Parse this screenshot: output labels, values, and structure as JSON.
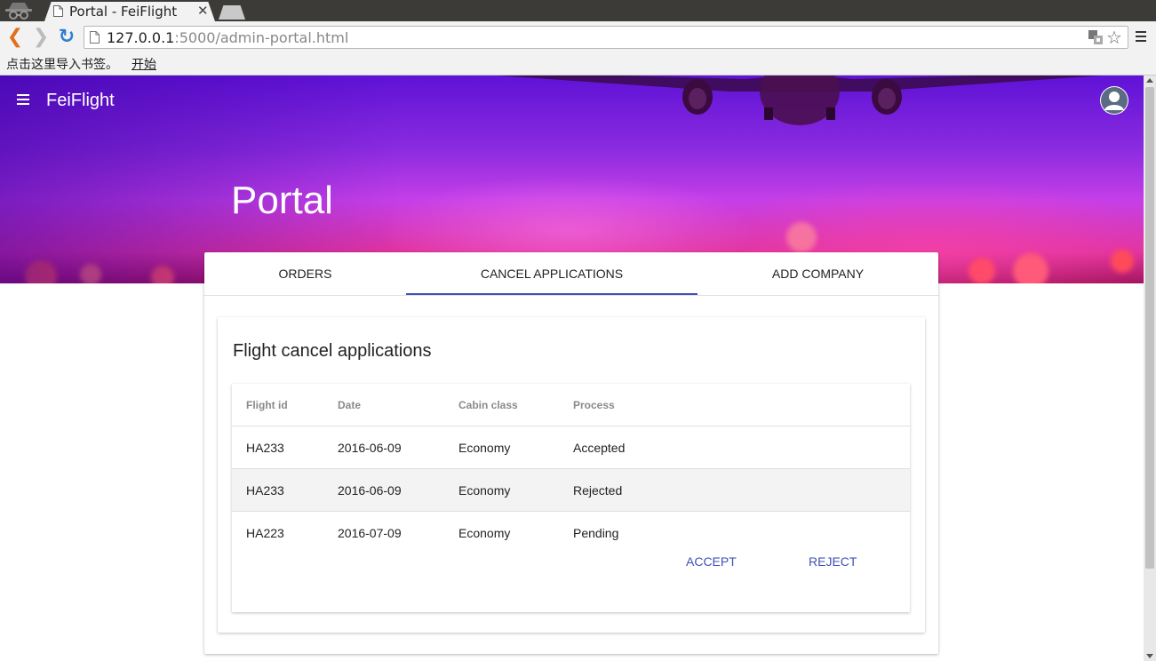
{
  "browser": {
    "tab_title": "Portal - FeiFlight",
    "tab_close": "✕",
    "url_host": "127.0.0.1",
    "url_rest": ":5000/admin-portal.html",
    "bookmarks_prompt": "点击这里导入书签。",
    "bookmarks_link": "开始",
    "back_glyph": "❮",
    "forward_glyph": "❯",
    "reload_glyph": "↻",
    "star_glyph": "☆"
  },
  "app": {
    "name": "FeiFlight",
    "page_title": "Portal",
    "accent_color": "#3f51b5"
  },
  "tabs": [
    {
      "label": "ORDERS"
    },
    {
      "label": "CANCEL APPLICATIONS"
    },
    {
      "label": "ADD COMPANY"
    }
  ],
  "active_tab": "CANCEL APPLICATIONS",
  "section": {
    "title": "Flight cancel applications"
  },
  "table": {
    "headers": [
      "Flight id",
      "Date",
      "Cabin class",
      "Process"
    ],
    "rows": [
      {
        "flight_id": "HA233",
        "date": "2016-06-09",
        "cabin": "Economy",
        "process": "Accepted"
      },
      {
        "flight_id": "HA233",
        "date": "2016-06-09",
        "cabin": "Economy",
        "process": "Rejected"
      },
      {
        "flight_id": "HA223",
        "date": "2016-07-09",
        "cabin": "Economy",
        "process": "Pending"
      }
    ],
    "actions": {
      "accept": "ACCEPT",
      "reject": "REJECT"
    }
  }
}
